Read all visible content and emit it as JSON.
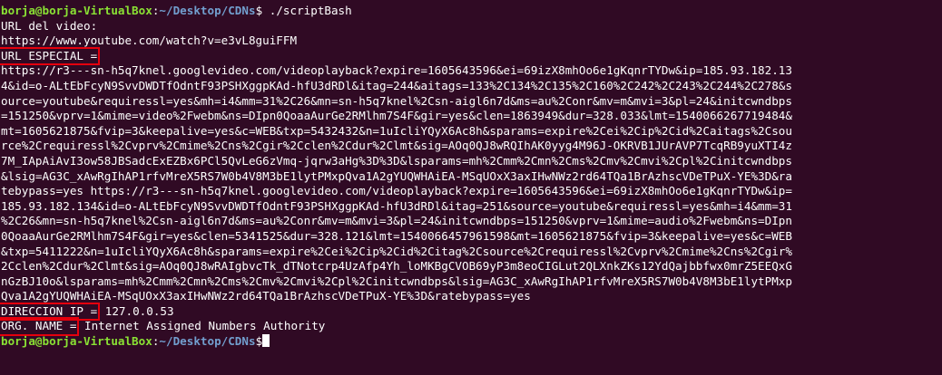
{
  "prompt": {
    "user_host": "borja@borja-VirtualBox",
    "separator": ":",
    "path": "~/Desktop/CDNs",
    "symbol": "$",
    "command": " ./scriptBash"
  },
  "output": {
    "video_label": "URL del video:",
    "video_url": "https://www.youtube.com/watch?v=e3vL8guiFFM",
    "special_label": "URL ESPECIAL =",
    "special_url_lines": [
      "https://r3---sn-h5q7knel.googlevideo.com/videoplayback?expire=1605643596&ei=69izX8mhOo6e1gKqnrTYDw&ip=185.93.182.13",
      "4&id=o-ALtEbFcyN9SvvDWDTfOdntF93PSHXggpKAd-hfU3dRDl&itag=244&aitags=133%2C134%2C135%2C160%2C242%2C243%2C244%2C278&s",
      "ource=youtube&requiressl=yes&mh=i4&mm=31%2C26&mn=sn-h5q7knel%2Csn-aigl6n7d&ms=au%2Conr&mv=m&mvi=3&pl=24&initcwndbps",
      "=151250&vprv=1&mime=video%2Fwebm&ns=DIpn0QoaaAurGe2RMlhm7S4F&gir=yes&clen=1863949&dur=328.033&lmt=1540066267719484&",
      "mt=1605621875&fvip=3&keepalive=yes&c=WEB&txp=5432432&n=1uIcliYQyX6Ac8h&sparams=expire%2Cei%2Cip%2Cid%2Caitags%2Csou",
      "rce%2Crequiressl%2Cvprv%2Cmime%2Cns%2Cgir%2Cclen%2Cdur%2Clmt&sig=AOq0QJ8wRQIhAK0yyg4M96J-OKRVB1JUrAVP7TcqRB9yuXTI4z",
      "7M_IApAiAvI3ow58JBSadcExEZBx6PCl5QvLeG6zVmq-jqrw3aHg%3D%3D&lsparams=mh%2Cmm%2Cmn%2Cms%2Cmv%2Cmvi%2Cpl%2Cinitcwndbps",
      "&lsig=AG3C_xAwRgIhAP1rfvMreX5RS7W0b4V8M3bE1lytPMxpQva1A2gYUQWHAiEA-MSqUOxX3axIHwNWz2rd64TQa1BrAzhscVDeTPuX-YE%3D&ra",
      "tebypass=yes https://r3---sn-h5q7knel.googlevideo.com/videoplayback?expire=1605643596&ei=69izX8mhOo6e1gKqnrTYDw&ip=",
      "185.93.182.134&id=o-ALtEbFcyN9SvvDWDTfOdntF93PSHXggpKAd-hfU3dRDl&itag=251&source=youtube&requiressl=yes&mh=i4&mm=31",
      "%2C26&mn=sn-h5q7knel%2Csn-aigl6n7d&ms=au%2Conr&mv=m&mvi=3&pl=24&initcwndbps=151250&vprv=1&mime=audio%2Fwebm&ns=DIpn",
      "0QoaaAurGe2RMlhm7S4F&gir=yes&clen=5341525&dur=328.121&lmt=1540066457961598&mt=1605621875&fvip=3&keepalive=yes&c=WEB",
      "&txp=5411222&n=1uIcliYQyX6Ac8h&sparams=expire%2Cei%2Cip%2Cid%2Citag%2Csource%2Crequiressl%2Cvprv%2Cmime%2Cns%2Cgir%",
      "2Cclen%2Cdur%2Clmt&sig=AOq0QJ8wRAIgbvcTk_dTNotcrp4UzAfp4Yh_loMKBgCVOB69yP3m8eoCIGLut2QLXnkZKs12YdQajbbfwx0mrZ5EEQxG",
      "nGzBJ10o&lsparams=mh%2Cmm%2Cmn%2Cms%2Cmv%2Cmvi%2Cpl%2Cinitcwndbps&lsig=AG3C_xAwRgIhAP1rfvMreX5RS7W0b4V8M3bE1lytPMxp",
      "Qva1A2gYUQWHAiEA-MSqUOxX3axIHwNWz2rd64TQa1BrAzhscVDeTPuX-YE%3D&ratebypass=yes"
    ],
    "ip_label": "DIRECCION IP =",
    "ip_value": " 127.0.0.53",
    "org_label": "ORG. NAME =",
    "org_value": " Internet Assigned Numbers Authority"
  },
  "colors": {
    "background": "#300a24",
    "prompt_user": "#8ae234",
    "prompt_path": "#729fcf",
    "highlight_box": "#e5000d",
    "text": "#ffffff"
  }
}
